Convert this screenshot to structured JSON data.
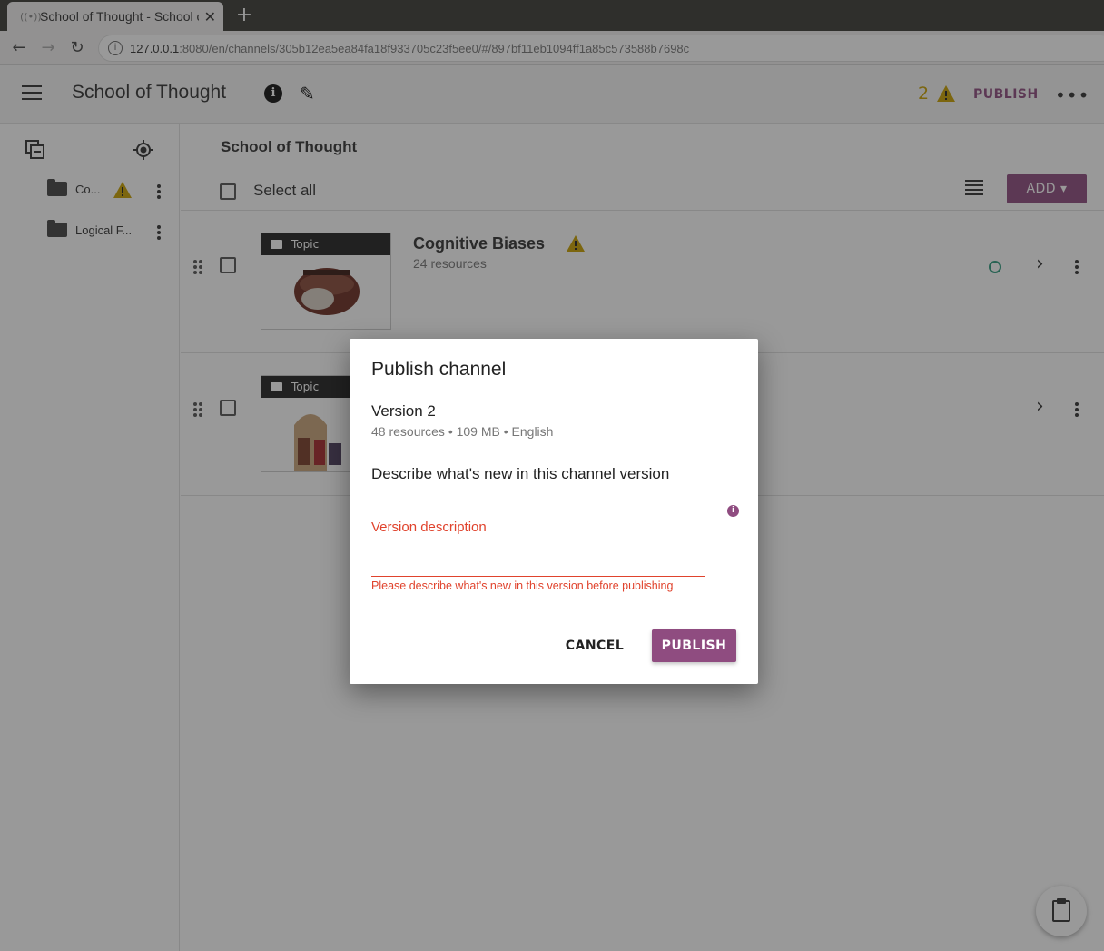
{
  "browser": {
    "tab_title": "School of Thought - School of Thought",
    "url_host": "127.0.0.1",
    "url_rest": ":8080/en/channels/305b12ea5ea84fa18f933705c23f5ee0/#/897bf11eb1094ff1a85c573588b7698c",
    "new_tab_symbol": "+",
    "close_symbol": "✕"
  },
  "appbar": {
    "channel_title": "School of Thought",
    "warning_count": "2",
    "publish_label": "PUBLISH",
    "colors": {
      "accent": "#8f4c80",
      "warning": "#c9a200",
      "error": "#e0432d",
      "status": "#2f9b7f"
    }
  },
  "sidebar": {
    "items": [
      {
        "label": "Co...",
        "has_warning": true
      },
      {
        "label": "Logical F...",
        "has_warning": false
      }
    ]
  },
  "main": {
    "breadcrumb": "School of Thought",
    "select_all": "Select all",
    "add_label": "ADD ▾",
    "nodes": [
      {
        "kind": "Topic",
        "title": "Cognitive Biases",
        "subtitle": "24 resources",
        "has_warning": true
      },
      {
        "kind": "Topic",
        "title": "",
        "subtitle": "",
        "has_warning": false
      }
    ]
  },
  "dialog": {
    "title": "Publish channel",
    "version": "Version 2",
    "meta": "48 resources • 109 MB • English",
    "describe_prompt": "Describe what's new in this channel version",
    "field_label": "Version description",
    "field_value": "",
    "error": "Please describe what's new in this version before publishing",
    "cancel_label": "CANCEL",
    "publish_label": "PUBLISH"
  }
}
